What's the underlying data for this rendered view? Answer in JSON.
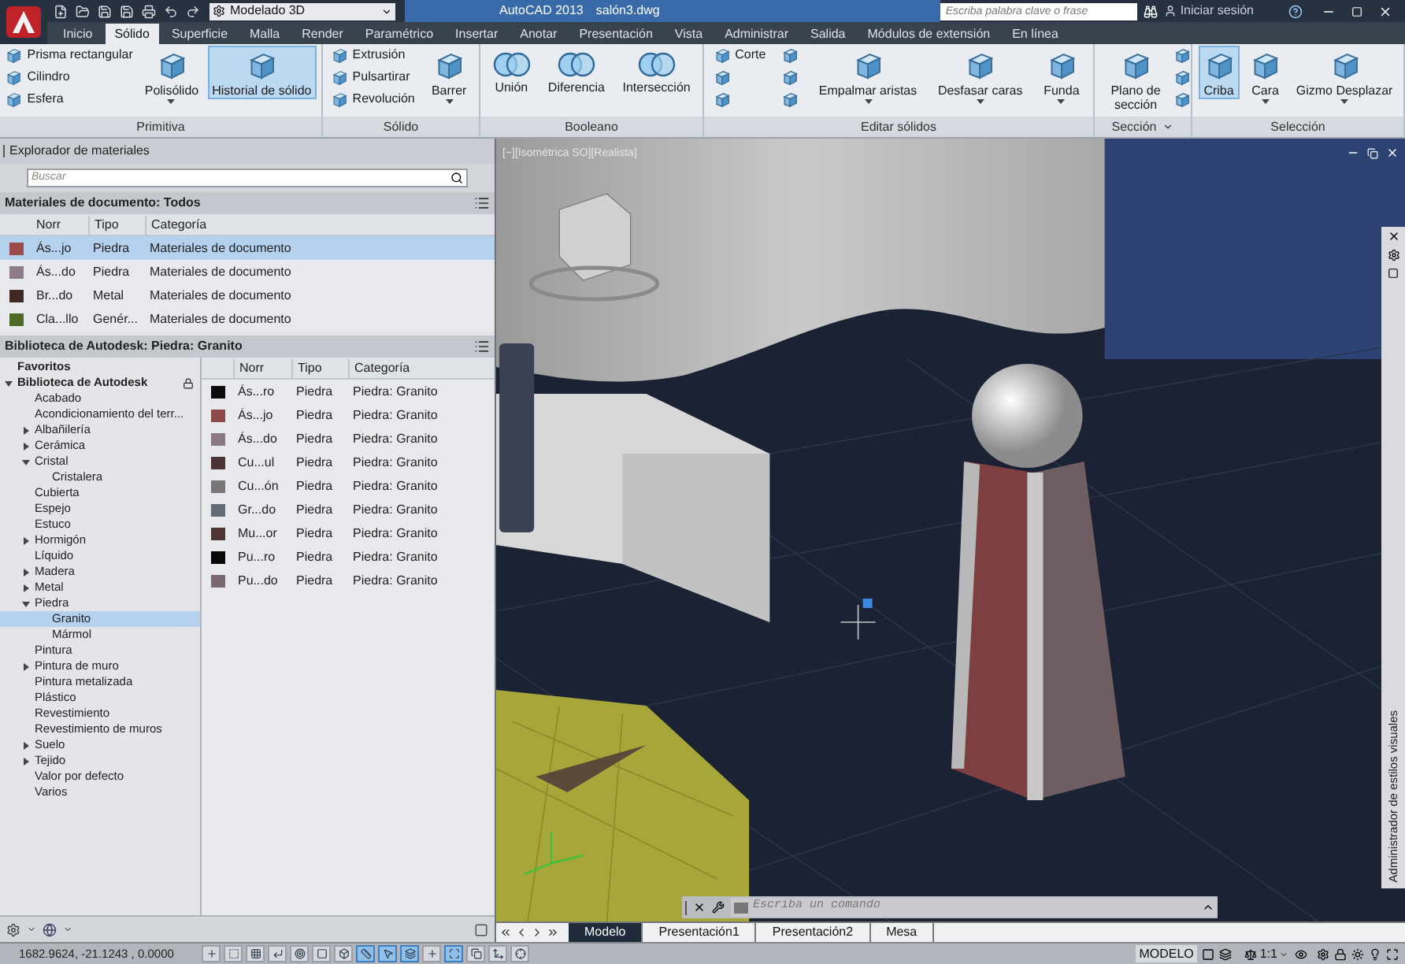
{
  "title_bar": {
    "workspace": "Modelado 3D",
    "app": "AutoCAD 2013",
    "file": "salón3.dwg",
    "search": {
      "placeholder": "Escriba palabra clave o frase"
    },
    "sign_in": "Iniciar sesión"
  },
  "tabs": [
    {
      "label": "Inicio",
      "selected": false
    },
    {
      "label": "Sólido",
      "selected": true
    },
    {
      "label": "Superficie",
      "selected": false
    },
    {
      "label": "Malla",
      "selected": false
    },
    {
      "label": "Render",
      "selected": false
    },
    {
      "label": "Paramétrico",
      "selected": false
    },
    {
      "label": "Insertar",
      "selected": false
    },
    {
      "label": "Anotar",
      "selected": false
    },
    {
      "label": "Presentación",
      "selected": false
    },
    {
      "label": "Vista",
      "selected": false
    },
    {
      "label": "Administrar",
      "selected": false
    },
    {
      "label": "Salida",
      "selected": false
    },
    {
      "label": "Módulos de extensión",
      "selected": false
    },
    {
      "label": "En línea",
      "selected": false
    }
  ],
  "ribbon": {
    "panels": [
      {
        "title": "Primitiva",
        "launcher": false,
        "groups": [
          {
            "kind": "stack",
            "items": [
              {
                "kind": "labeled",
                "label": "Prisma rectangular"
              },
              {
                "kind": "labeled",
                "label": "Cilindro"
              },
              {
                "kind": "labeled",
                "label": "Esfera"
              }
            ]
          },
          {
            "kind": "large",
            "label": "Polisólido",
            "dropdown": true,
            "active": false,
            "wrap": false
          },
          {
            "kind": "large",
            "label": "Historial de sólido",
            "dropdown": false,
            "active": true,
            "wrap": false
          }
        ]
      },
      {
        "title": "Sólido",
        "launcher": false,
        "groups": [
          {
            "kind": "stack",
            "items": [
              {
                "kind": "labeled",
                "label": "Extrusión"
              },
              {
                "kind": "labeled",
                "label": "Pulsartirar"
              },
              {
                "kind": "labeled",
                "label": "Revolución"
              }
            ]
          },
          {
            "kind": "large",
            "label": "Barrer",
            "dropdown": true,
            "active": false,
            "wrap": false
          }
        ]
      },
      {
        "title": "Booleano",
        "launcher": false,
        "groups": [
          {
            "kind": "large",
            "label": "Unión",
            "dropdown": false,
            "active": false,
            "wrap": false
          },
          {
            "kind": "large",
            "label": "Diferencia",
            "dropdown": false,
            "active": false,
            "wrap": false
          },
          {
            "kind": "large",
            "label": "Intersección",
            "dropdown": false,
            "active": false,
            "wrap": false
          }
        ]
      },
      {
        "title": "Editar sólidos",
        "launcher": false,
        "groups": [
          {
            "kind": "stack",
            "items": [
              {
                "kind": "labeled",
                "label": "Corte"
              },
              {
                "kind": "icon"
              },
              {
                "kind": "icon"
              }
            ]
          },
          {
            "kind": "stack",
            "items": [
              {
                "kind": "icon"
              },
              {
                "kind": "icon"
              },
              {
                "kind": "icon"
              }
            ]
          },
          {
            "kind": "large",
            "label": "Empalmar aristas",
            "dropdown": true,
            "active": false,
            "wrap": false
          },
          {
            "kind": "large",
            "label": "Desfasar caras",
            "dropdown": true,
            "active": false,
            "wrap": false
          },
          {
            "kind": "large",
            "label": "Funda",
            "dropdown": true,
            "active": false,
            "wrap": false
          }
        ]
      },
      {
        "title": "Sección",
        "launcher": true,
        "groups": [
          {
            "kind": "large",
            "label": "Plano de sección",
            "dropdown": false,
            "active": false,
            "wrap": true
          },
          {
            "kind": "stack",
            "items": [
              {
                "kind": "icon"
              },
              {
                "kind": "icon"
              },
              {
                "kind": "icon"
              }
            ]
          }
        ]
      },
      {
        "title": "Selección",
        "launcher": false,
        "groups": [
          {
            "kind": "large",
            "label": "Criba",
            "dropdown": false,
            "active": true,
            "wrap": false
          },
          {
            "kind": "large",
            "label": "Cara",
            "dropdown": true,
            "active": false,
            "wrap": false
          },
          {
            "kind": "large",
            "label": "Gizmo Desplazar",
            "dropdown": true,
            "active": false,
            "wrap": false
          }
        ]
      }
    ]
  },
  "materials": {
    "title": "Explorador de materiales",
    "search": {
      "placeholder": "Buscar"
    },
    "document": {
      "title": "Materiales de documento: Todos",
      "columns": [
        "Norr",
        "Tipo",
        "Categoría"
      ],
      "rows": [
        {
          "color": "#9a4c4a",
          "name": "Ás...jo",
          "type": "Piedra",
          "category": "Materiales de documento",
          "selected": true
        },
        {
          "color": "#8e7c8a",
          "name": "Ás...do",
          "type": "Piedra",
          "category": "Materiales de documento",
          "selected": false
        },
        {
          "color": "#3e2a22",
          "name": "Br...do",
          "type": "Metal",
          "category": "Materiales de documento",
          "selected": false
        },
        {
          "color": "#4c6a26",
          "name": "Cla...llo",
          "type": "Genér...",
          "category": "Materiales de documento",
          "selected": false
        }
      ]
    },
    "library": {
      "title": "Biblioteca de Autodesk: Piedra: Granito",
      "tree": [
        {
          "label": "Favoritos",
          "bold": true,
          "locked": false,
          "selected": false
        },
        {
          "label": "Biblioteca de Autodesk",
          "expanded": true,
          "bold": true,
          "locked": true,
          "selected": false,
          "children": [
            {
              "label": "Acabado",
              "selected": false
            },
            {
              "label": "Acondicionamiento del terr...",
              "selected": false
            },
            {
              "label": "Albañilería",
              "expanded": false,
              "selected": false
            },
            {
              "label": "Cerámica",
              "expanded": false,
              "selected": false
            },
            {
              "label": "Cristal",
              "expanded": true,
              "selected": false,
              "children": [
                {
                  "label": "Cristalera",
                  "selected": false
                }
              ]
            },
            {
              "label": "Cubierta",
              "selected": false
            },
            {
              "label": "Espejo",
              "selected": false
            },
            {
              "label": "Estuco",
              "selected": false
            },
            {
              "label": "Hormigón",
              "expanded": false,
              "selected": false
            },
            {
              "label": "Líquido",
              "selected": false
            },
            {
              "label": "Madera",
              "expanded": false,
              "selected": false
            },
            {
              "label": "Metal",
              "expanded": false,
              "selected": false
            },
            {
              "label": "Piedra",
              "expanded": true,
              "selected": false,
              "children": [
                {
                  "label": "Granito",
                  "selected": true
                },
                {
                  "label": "Mármol",
                  "selected": false
                }
              ]
            },
            {
              "label": "Pintura",
              "selected": false
            },
            {
              "label": "Pintura de muro",
              "expanded": false,
              "selected": false
            },
            {
              "label": "Pintura metalizada",
              "selected": false
            },
            {
              "label": "Plástico",
              "selected": false
            },
            {
              "label": "Revestimiento",
              "selected": false
            },
            {
              "label": "Revestimiento de muros",
              "selected": false
            },
            {
              "label": "Suelo",
              "expanded": false,
              "selected": false
            },
            {
              "label": "Tejido",
              "expanded": false,
              "selected": false
            },
            {
              "label": "Valor por defecto",
              "selected": false
            },
            {
              "label": "Varios",
              "selected": false
            }
          ]
        }
      ],
      "columns": [
        "Norr",
        "Tipo",
        "Categoría"
      ],
      "rows": [
        {
          "color": "#0c0c0c",
          "name": "Ás...ro",
          "type": "Piedra",
          "category": "Piedra: Granito"
        },
        {
          "color": "#8e4a48",
          "name": "Ás...jo",
          "type": "Piedra",
          "category": "Piedra: Granito"
        },
        {
          "color": "#8a7884",
          "name": "Ás...do",
          "type": "Piedra",
          "category": "Piedra: Granito"
        },
        {
          "color": "#4a3438",
          "name": "Cu...ul",
          "type": "Piedra",
          "category": "Piedra: Granito"
        },
        {
          "color": "#7a7676",
          "name": "Cu...ón",
          "type": "Piedra",
          "category": "Piedra: Granito"
        },
        {
          "color": "#646a76",
          "name": "Gr...do",
          "type": "Piedra",
          "category": "Piedra: Granito"
        },
        {
          "color": "#4e3432",
          "name": "Mu...or",
          "type": "Piedra",
          "category": "Piedra: Granito"
        },
        {
          "color": "#080808",
          "name": "Pu...ro",
          "type": "Piedra",
          "category": "Piedra: Granito"
        },
        {
          "color": "#7c6870",
          "name": "Pu...do",
          "type": "Piedra",
          "category": "Piedra: Granito"
        }
      ]
    }
  },
  "viewport": {
    "label": "[−][Isométrica SO][Realista]",
    "palette_title": "Administrador de estilos visuales",
    "command_line": {
      "placeholder": "Escriba un comando"
    }
  },
  "layout_tabs": [
    {
      "label": "Modelo",
      "selected": true
    },
    {
      "label": "Presentación1",
      "selected": false
    },
    {
      "label": "Presentación2",
      "selected": false
    },
    {
      "label": "Mesa",
      "selected": false
    }
  ],
  "status_bar": {
    "coordinates": "1682.9624, -21.1243 , 0.0000",
    "toggles": [
      {
        "on": false
      },
      {
        "on": false
      },
      {
        "on": false
      },
      {
        "on": false
      },
      {
        "on": false
      },
      {
        "on": false
      },
      {
        "on": false
      },
      {
        "on": true
      },
      {
        "on": true
      },
      {
        "on": true
      },
      {
        "on": false
      },
      {
        "on": true
      },
      {
        "on": false
      },
      {
        "on": false
      },
      {
        "on": false
      }
    ],
    "space": "MODELO",
    "scale": "1:1"
  }
}
